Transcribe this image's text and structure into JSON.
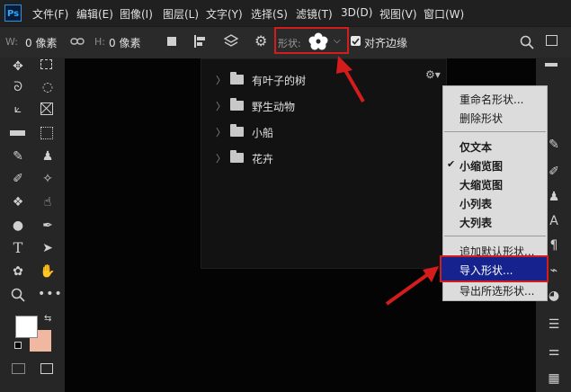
{
  "app": {
    "logo_text": "Ps"
  },
  "menubar": {
    "items": [
      "文件(F)",
      "编辑(E)",
      "图像(I)",
      "图层(L)",
      "文字(Y)",
      "选择(S)",
      "滤镜(T)",
      "3D(D)",
      "视图(V)",
      "窗口(W)"
    ]
  },
  "options": {
    "w_label": "W:",
    "w_value": "0 像素",
    "h_label": "H:",
    "h_value": "0 像素",
    "shape_label": "形状:",
    "align_edges_label": "对齐边缘",
    "align_edges_checked": true
  },
  "picker": {
    "folders": [
      "有叶子的树",
      "野生动物",
      "小船",
      "花卉"
    ]
  },
  "context_menu": {
    "items": {
      "rename": "重命名形状...",
      "delete": "删除形状",
      "text_only": "仅文本",
      "small_thumb": "小缩览图",
      "large_thumb": "大缩览图",
      "small_list": "小列表",
      "large_list": "大列表",
      "append_default": "追加默认形状...",
      "import": "导入形状...",
      "export": "导出所选形状..."
    },
    "checkmark": "✔",
    "checked_item": "small_thumb",
    "highlighted_item": "import"
  },
  "colors": {
    "foreground": "#ffffff",
    "background": "#f0b8a0",
    "highlight": "#16238e",
    "annotation_red": "#d41c1c"
  }
}
